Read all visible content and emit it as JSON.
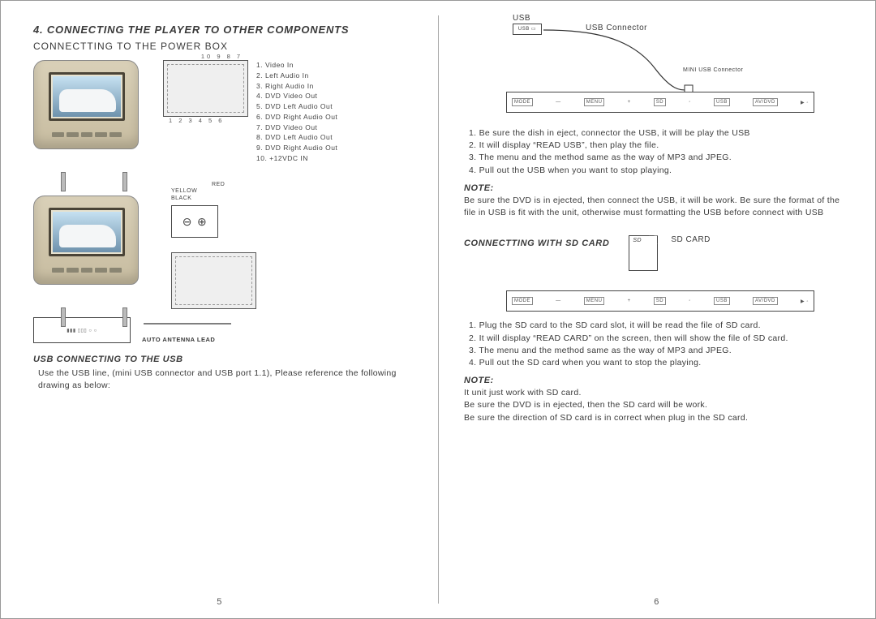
{
  "page_left": {
    "num": "5",
    "section_title": "4. CONNECTING THE PLAYER TO OTHER COMPONENTS",
    "subtitle": "CONNECTTING TO THE POWER BOX",
    "legend": [
      "1. Video  In",
      "2. Left  Audio  In",
      "3. Right  Audio  In",
      "4. DVD  Video  Out",
      "5. DVD  Left  Audio  Out",
      "6. DVD  Right  Audio  Out",
      "7. DVD  Video  Out",
      "8. DVD  Left  Audio  Out",
      "9. DVD  Right  Audio  Out",
      "10. +12VDC  IN"
    ],
    "power_nums_top": "10   9  8  7",
    "power_nums_bot": "1  2  3  4  5  6",
    "wire_colors": {
      "red": "RED",
      "yellow": "YELLOW",
      "black": "BLACK"
    },
    "antenna": "AUTO  ANTENNA  LEAD",
    "usb_heading": "USB CONNECTING TO THE USB",
    "usb_text": "Use the USB line, (mini USB connector and USB port 1.1), Please reference the following drawing as below:"
  },
  "page_right": {
    "num": "6",
    "usb_label": "USB",
    "usb_connector": "USB Connector",
    "mini_usb": "MINI USB Connector",
    "panel": {
      "mode": "MODE",
      "menu": "MENU",
      "sd": "SD",
      "usb": "USB",
      "avdvd": "AV/DVD"
    },
    "usb_steps": [
      "1. Be sure the dish in eject, connector the USB, it will be play the USB",
      "2.  It will display “READ USB”, then play the file.",
      "3. The menu and the method same as the way of MP3 and JPEG.",
      "4. Pull out the USB when you want to stop playing."
    ],
    "note_label": "NOTE:",
    "usb_note": "   Be sure the DVD is in ejected, then connect the USB, it will be work. Be sure the format of the file in USB is fit with the unit, otherwise must formatting the USB before connect with USB",
    "sd_heading": "CONNECTTING WITH SD CARD",
    "sd_card_label": "SD CARD",
    "sd_tag": "SD",
    "sd_steps": [
      "1. Plug the SD card to the SD card slot, it will be read the file of SD card.",
      "2.  It will display “READ CARD” on the screen, then will show the file of SD card.",
      "3. The menu and the method same as the way of MP3 and JPEG.",
      "4. Pull out the SD card when you want to stop the playing."
    ],
    "sd_note": [
      "It unit just work with SD card.",
      "Be sure the DVD is in ejected, then the SD card will be work.",
      "Be sure the direction of SD card is in correct when plug in the SD card."
    ]
  }
}
